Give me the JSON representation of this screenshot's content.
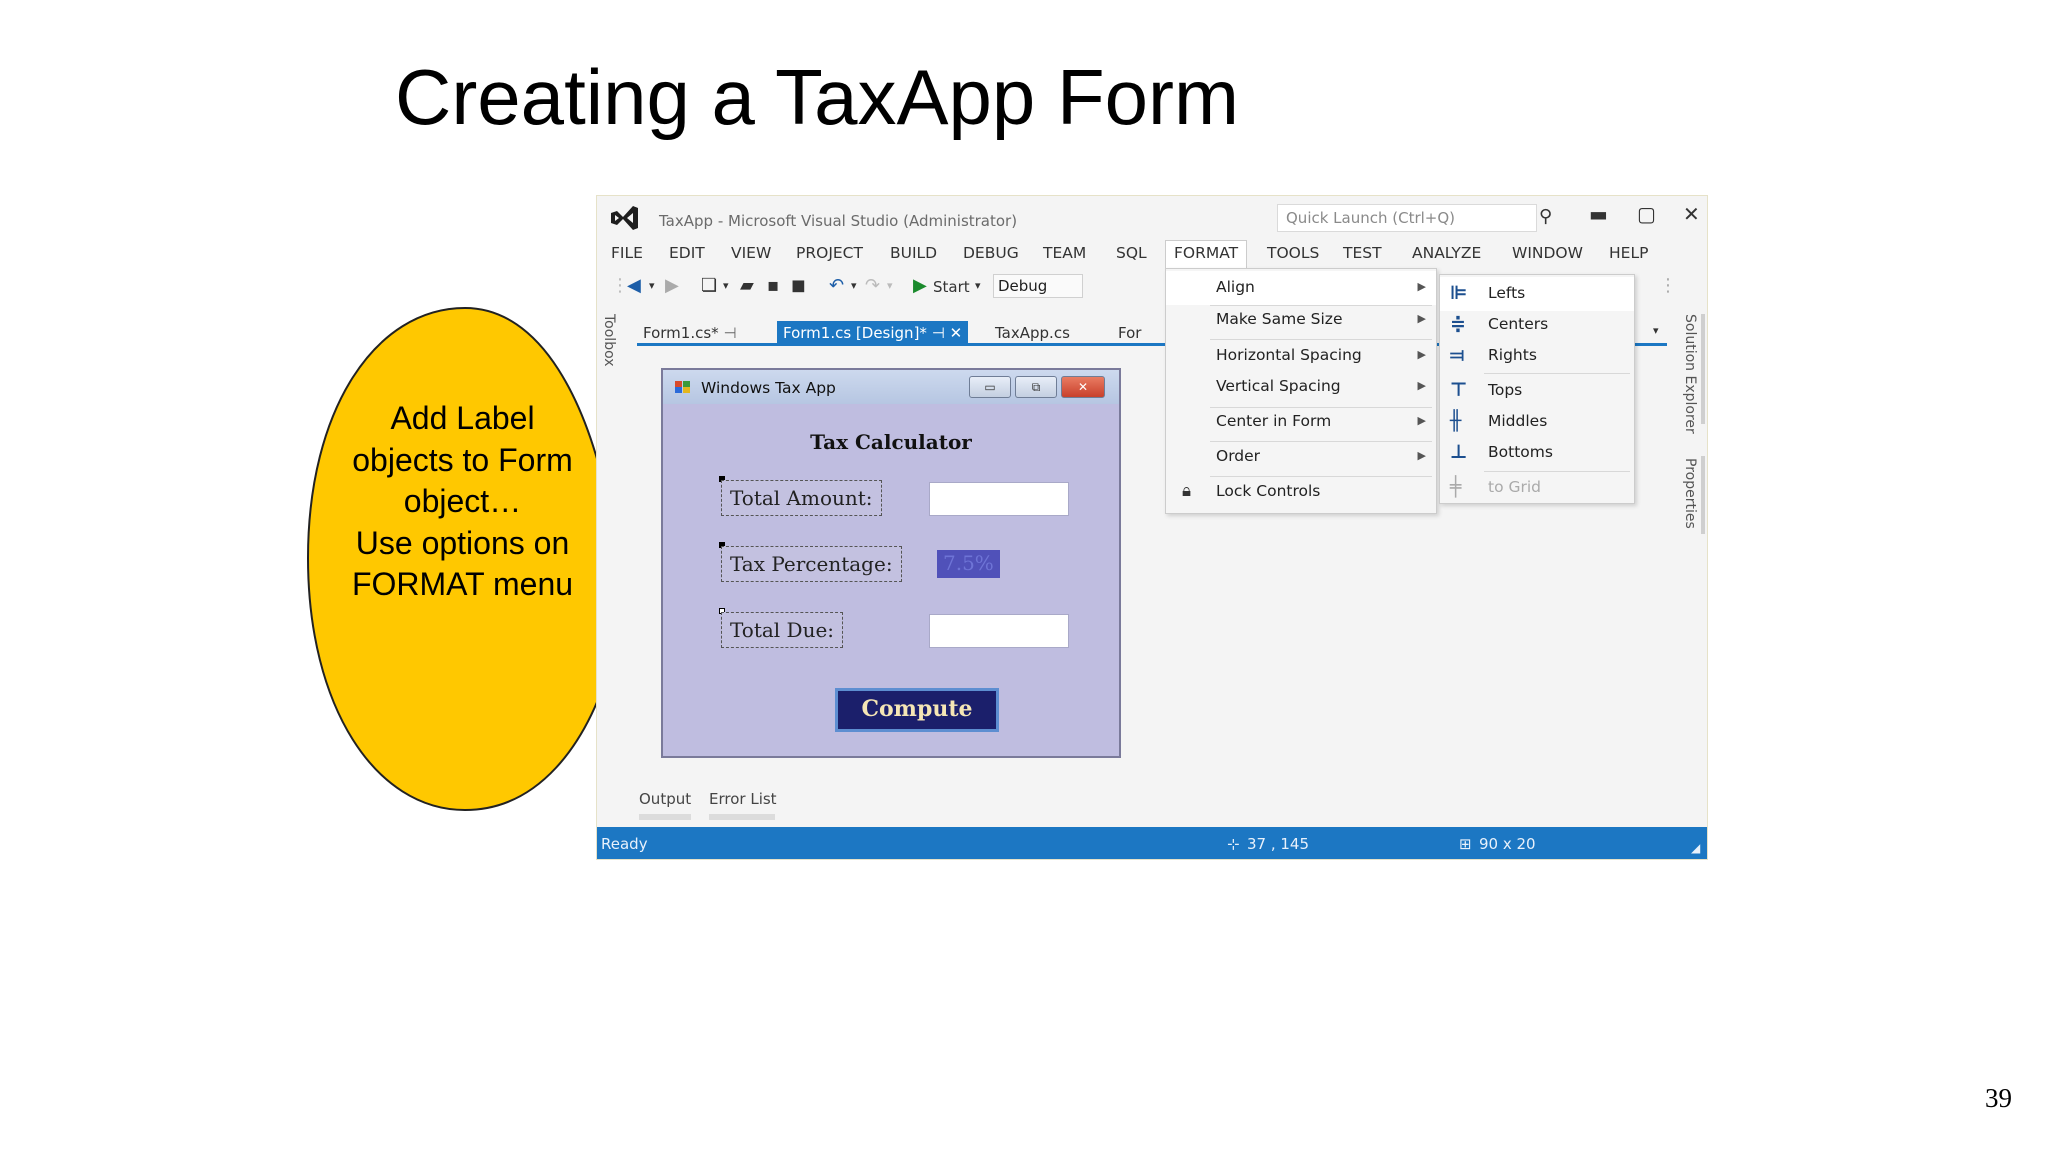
{
  "slide": {
    "title": "Creating a TaxApp Form",
    "page_number": "39",
    "callout": "Add Label objects to Form object…\nUse options on FORMAT menu"
  },
  "window": {
    "title": "TaxApp - Microsoft Visual Studio (Administrator)",
    "quick_launch_placeholder": "Quick Launch (Ctrl+Q)"
  },
  "menubar": [
    "FILE",
    "EDIT",
    "VIEW",
    "PROJECT",
    "BUILD",
    "DEBUG",
    "TEAM",
    "SQL",
    "FORMAT",
    "TOOLS",
    "TEST",
    "ANALYZE",
    "WINDOW",
    "HELP"
  ],
  "toolbar": {
    "start_label": "Start",
    "config_value": "Debug"
  },
  "side_panels": {
    "toolbox": "Toolbox",
    "solution_explorer": "Solution Explorer",
    "properties": "Properties"
  },
  "doc_tabs": [
    "Form1.cs*",
    "Form1.cs [Design]*",
    "TaxApp.cs",
    "For"
  ],
  "form": {
    "title": "Windows Tax App",
    "heading": "Tax Calculator",
    "labels": [
      "Total Amount:",
      "Tax Percentage:",
      "Total Due:"
    ],
    "tax_value": "7.5%",
    "compute_label": "Compute"
  },
  "format_menu": [
    {
      "label": "Align",
      "submenu": true
    },
    {
      "label": "Make Same Size",
      "submenu": true
    },
    {
      "label": "Horizontal Spacing",
      "submenu": true
    },
    {
      "label": "Vertical Spacing",
      "submenu": true
    },
    {
      "label": "Center in Form",
      "submenu": true
    },
    {
      "label": "Order",
      "submenu": true
    },
    {
      "label": "Lock Controls",
      "submenu": false
    }
  ],
  "align_submenu": [
    "Lefts",
    "Centers",
    "Rights",
    "Tops",
    "Middles",
    "Bottoms",
    "to Grid"
  ],
  "bottom_tabs": [
    "Output",
    "Error List"
  ],
  "status": {
    "text": "Ready",
    "position": "37 , 145",
    "size": "90 x 20"
  },
  "colors": {
    "callout_fill": "#ffc800",
    "vs_accent": "#1c77c3",
    "form_background": "#bfbde0",
    "compute_button": "#1b1f6b"
  }
}
